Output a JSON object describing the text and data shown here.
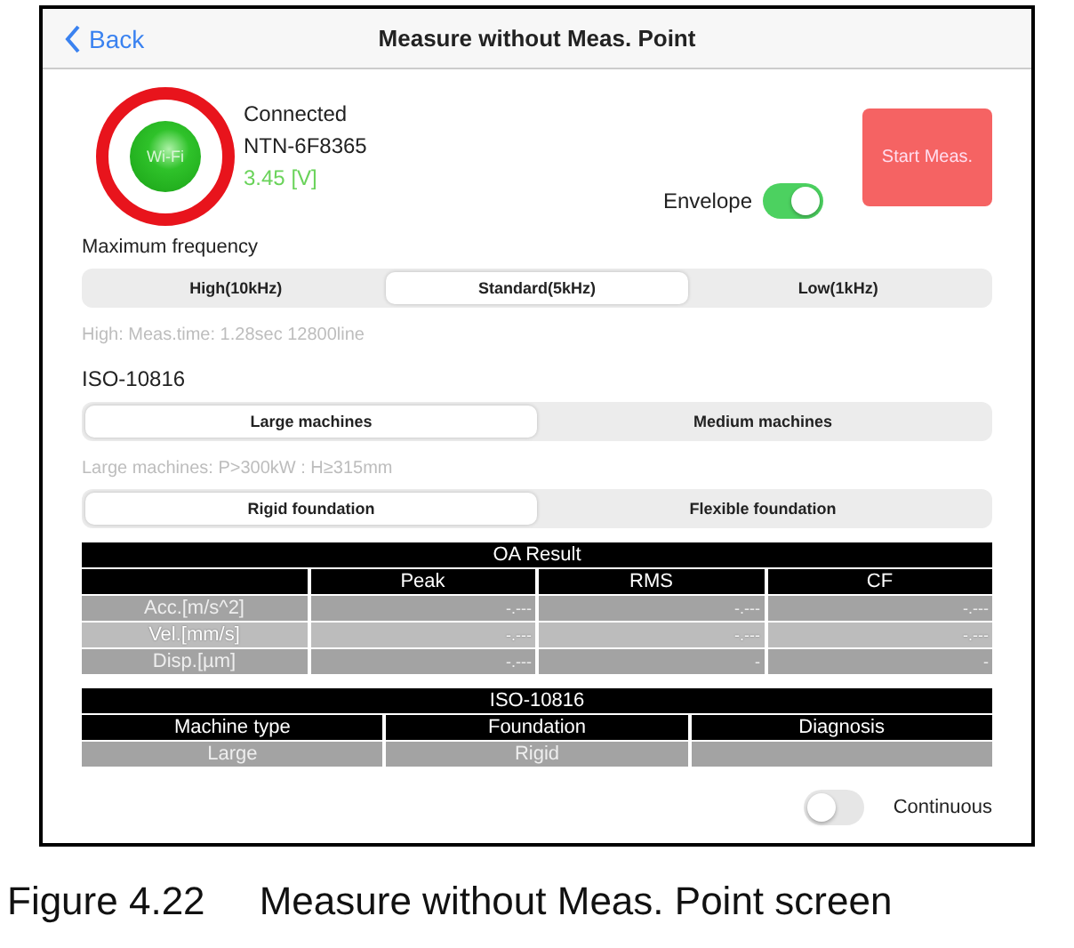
{
  "nav": {
    "back": "Back",
    "title": "Measure without Meas. Point"
  },
  "connection": {
    "icon_label": "Wi-Fi",
    "status": "Connected",
    "device": "NTN-6F8365",
    "voltage": "3.45 [V]",
    "highlighted": true
  },
  "envelope": {
    "label": "Envelope",
    "on": true
  },
  "start_button": "Start Meas.",
  "frequency": {
    "label": "Maximum frequency",
    "options": [
      {
        "label": "High(10kHz)",
        "selected": false
      },
      {
        "label": "Standard(5kHz)",
        "selected": true
      },
      {
        "label": "Low(1kHz)",
        "selected": false
      }
    ],
    "hint": "High:  Meas.time: 1.28sec 12800line"
  },
  "iso": {
    "label": "ISO-10816",
    "machines": [
      {
        "label": "Large machines",
        "selected": true
      },
      {
        "label": "Medium machines",
        "selected": false
      }
    ],
    "hint": "Large machines: P>300kW : H≥315mm",
    "foundations": [
      {
        "label": "Rigid foundation",
        "selected": true
      },
      {
        "label": "Flexible foundation",
        "selected": false
      }
    ]
  },
  "oa_table": {
    "title": "OA Result",
    "columns": [
      "Peak",
      "RMS",
      "CF"
    ],
    "rows": [
      {
        "name": "Acc.[m/s^2]",
        "values": [
          "-.---",
          "-.---",
          "-.---"
        ]
      },
      {
        "name": "Vel.[mm/s]",
        "values": [
          "-.---",
          "-.---",
          "-.---"
        ]
      },
      {
        "name": "Disp.[µm]",
        "values": [
          "-.---",
          "-",
          "-"
        ]
      }
    ]
  },
  "iso_table": {
    "title": "ISO-10816",
    "columns": [
      "Machine type",
      "Foundation",
      "Diagnosis"
    ],
    "rows": [
      [
        "Large",
        "Rigid",
        ""
      ]
    ]
  },
  "continuous": {
    "label": "Continuous",
    "on": false
  },
  "caption": "Figure 4.22     Measure without Meas. Point screen"
}
